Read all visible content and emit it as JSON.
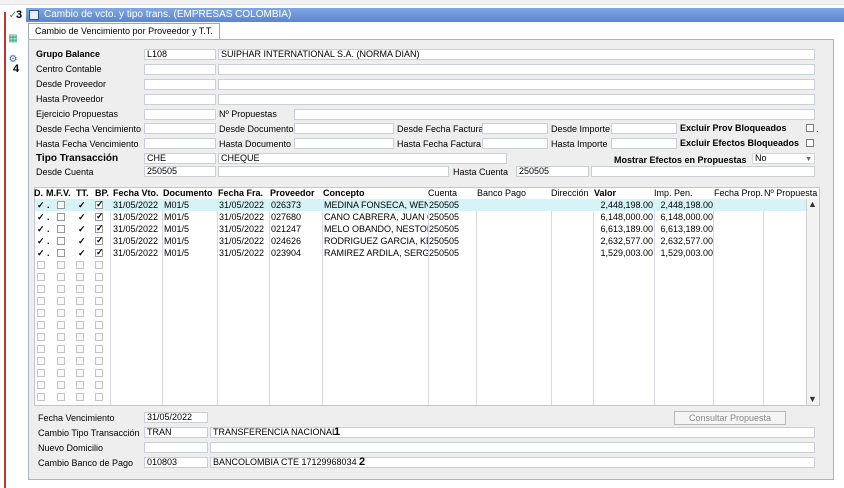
{
  "window": {
    "title": "Cambio de vcto. y tipo trans. (EMPRESAS COLOMBIA)",
    "tab": "Cambio de Vencimiento por Proveedor y T.T."
  },
  "markers": [
    "3",
    "4",
    "1",
    "2"
  ],
  "icons": {
    "check": "✓",
    "grid": "▦",
    "gear": "⚙"
  },
  "filters": {
    "grupo_balance": {
      "label": "Grupo Balance",
      "code": "L108",
      "name": "SUIPHAR INTERNATIONAL S.A. (NORMA DIAN)"
    },
    "centro_contable": {
      "label": "Centro Contable"
    },
    "desde_proveedor": {
      "label": "Desde Proveedor"
    },
    "hasta_proveedor": {
      "label": "Hasta Proveedor"
    },
    "ejercicio_propuestas": {
      "label": "Ejercicio Propuestas"
    },
    "n_propuestas": {
      "label": "Nº Propuestas"
    },
    "desde_fecha_venc": {
      "label": "Desde Fecha Vencimiento"
    },
    "hasta_fecha_venc": {
      "label": "Hasta Fecha Vencimiento"
    },
    "desde_documento": {
      "label": "Desde Documento"
    },
    "hasta_documento": {
      "label": "Hasta Documento"
    },
    "desde_fecha_factura": {
      "label": "Desde Fecha Factura"
    },
    "hasta_fecha_factura": {
      "label": "Hasta Fecha Factura"
    },
    "desde_importe": {
      "label": "Desde Importe"
    },
    "hasta_importe": {
      "label": "Hasta Importe"
    },
    "excluir_prov": {
      "label": "Excluir Prov Bloqueados"
    },
    "excluir_efectos": {
      "label": "Excluir Efectos Bloqueados"
    },
    "tipo_transaccion": {
      "label": "Tipo Transacción",
      "code": "CHE",
      "name": "CHEQUE"
    },
    "mostrar_efectos": {
      "label": "Mostrar Efectos en Propuestas",
      "value": "No"
    },
    "desde_cuenta": {
      "label": "Desde Cuenta",
      "value": "250505"
    },
    "hasta_cuenta": {
      "label": "Hasta Cuenta",
      "value": "250505"
    }
  },
  "grid": {
    "columns": [
      "D.",
      "M.",
      "F.V.",
      "TT.",
      "BP.",
      "Fecha Vto.",
      "Documento",
      "Fecha Fra.",
      "Proveedor",
      "Concepto",
      "Cuenta",
      "Banco Pago",
      "Dirección",
      "Valor",
      "Imp. Pen.",
      "Fecha Prop.",
      "Nº Propuesta"
    ],
    "rows": [
      {
        "fecha_vto": "31/05/2022",
        "documento": "M01/5",
        "fecha_fra": "31/05/2022",
        "proveedor": "026373",
        "concepto": "MEDINA FONSECA, WEND",
        "cuenta": "250505",
        "valor": "2,448,198.00",
        "imp_pen": "2,448,198.00"
      },
      {
        "fecha_vto": "31/05/2022",
        "documento": "M01/5",
        "fecha_fra": "31/05/2022",
        "proveedor": "027680",
        "concepto": "CANO CABRERA, JUAN C/",
        "cuenta": "250505",
        "valor": "6,148,000.00",
        "imp_pen": "6,148,000.00"
      },
      {
        "fecha_vto": "31/05/2022",
        "documento": "M01/5",
        "fecha_fra": "31/05/2022",
        "proveedor": "021247",
        "concepto": "MELO OBANDO, NESTOR I",
        "cuenta": "250505",
        "valor": "6,613,189.00",
        "imp_pen": "6,613,189.00"
      },
      {
        "fecha_vto": "31/05/2022",
        "documento": "M01/5",
        "fecha_fra": "31/05/2022",
        "proveedor": "024626",
        "concepto": "RODRIGUEZ GARCIA, KEV",
        "cuenta": "250505",
        "valor": "2,632,577.00",
        "imp_pen": "2,632,577.00"
      },
      {
        "fecha_vto": "31/05/2022",
        "documento": "M01/5",
        "fecha_fra": "31/05/2022",
        "proveedor": "023904",
        "concepto": "RAMIREZ ARDILA, SERGI(",
        "cuenta": "250505",
        "valor": "1,529,003.00",
        "imp_pen": "1,529,003.00"
      }
    ],
    "empty_rows": 12
  },
  "footer": {
    "fecha_venc": {
      "label": "Fecha Vencimiento",
      "value": "31/05/2022"
    },
    "cambio_tt": {
      "label": "Cambio Tipo Transacción",
      "code": "TRAN",
      "name": "TRANSFERENCIA NACIONAL"
    },
    "nuevo_domicilio": {
      "label": "Nuevo Domicilio"
    },
    "cambio_banco": {
      "label": "Cambio Banco de Pago",
      "code": "010803",
      "name": "BANCOLOMBIA CTE 17129968034"
    },
    "consultar_button": "Consultar Propuesta"
  }
}
